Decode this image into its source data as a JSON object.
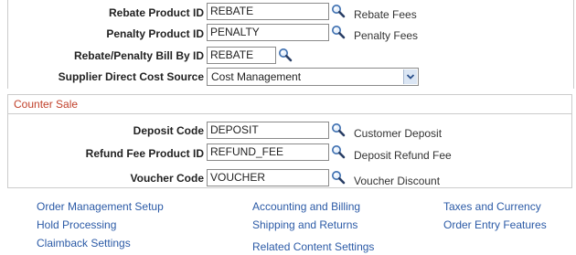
{
  "fields": {
    "rebate_product": {
      "label": "Rebate Product ID",
      "value": "REBATE",
      "description": "Rebate Fees"
    },
    "penalty_product": {
      "label": "Penalty Product ID",
      "value": "PENALTY",
      "description": "Penalty Fees"
    },
    "rebate_penalty_bill": {
      "label": "Rebate/Penalty Bill By ID",
      "value": "REBATE"
    },
    "supplier_direct_cost": {
      "label": "Supplier Direct Cost Source",
      "selected": "Cost Management"
    }
  },
  "counter_sale": {
    "title": "Counter Sale",
    "deposit_code": {
      "label": "Deposit Code",
      "value": "DEPOSIT",
      "description": "Customer Deposit"
    },
    "refund_fee_product": {
      "label": "Refund Fee Product ID",
      "value": "REFUND_FEE",
      "description": "Deposit Refund Fee"
    },
    "voucher_code": {
      "label": "Voucher Code",
      "value": "VOUCHER",
      "description": "Voucher Discount"
    }
  },
  "links": {
    "col1": [
      "Order Management Setup",
      "Hold Processing",
      "Claimback Settings"
    ],
    "col2": [
      "Accounting and Billing",
      "Shipping and Returns",
      "Related Content Settings"
    ],
    "col3": [
      "Taxes and Currency",
      "Order Entry Features"
    ]
  },
  "colors": {
    "section_title": "#c1402a",
    "link": "#2b5aa6",
    "border": "#cbcbcb"
  },
  "icons": {
    "lookup": "magnifier-icon",
    "dropdown": "chevron-down-icon"
  }
}
